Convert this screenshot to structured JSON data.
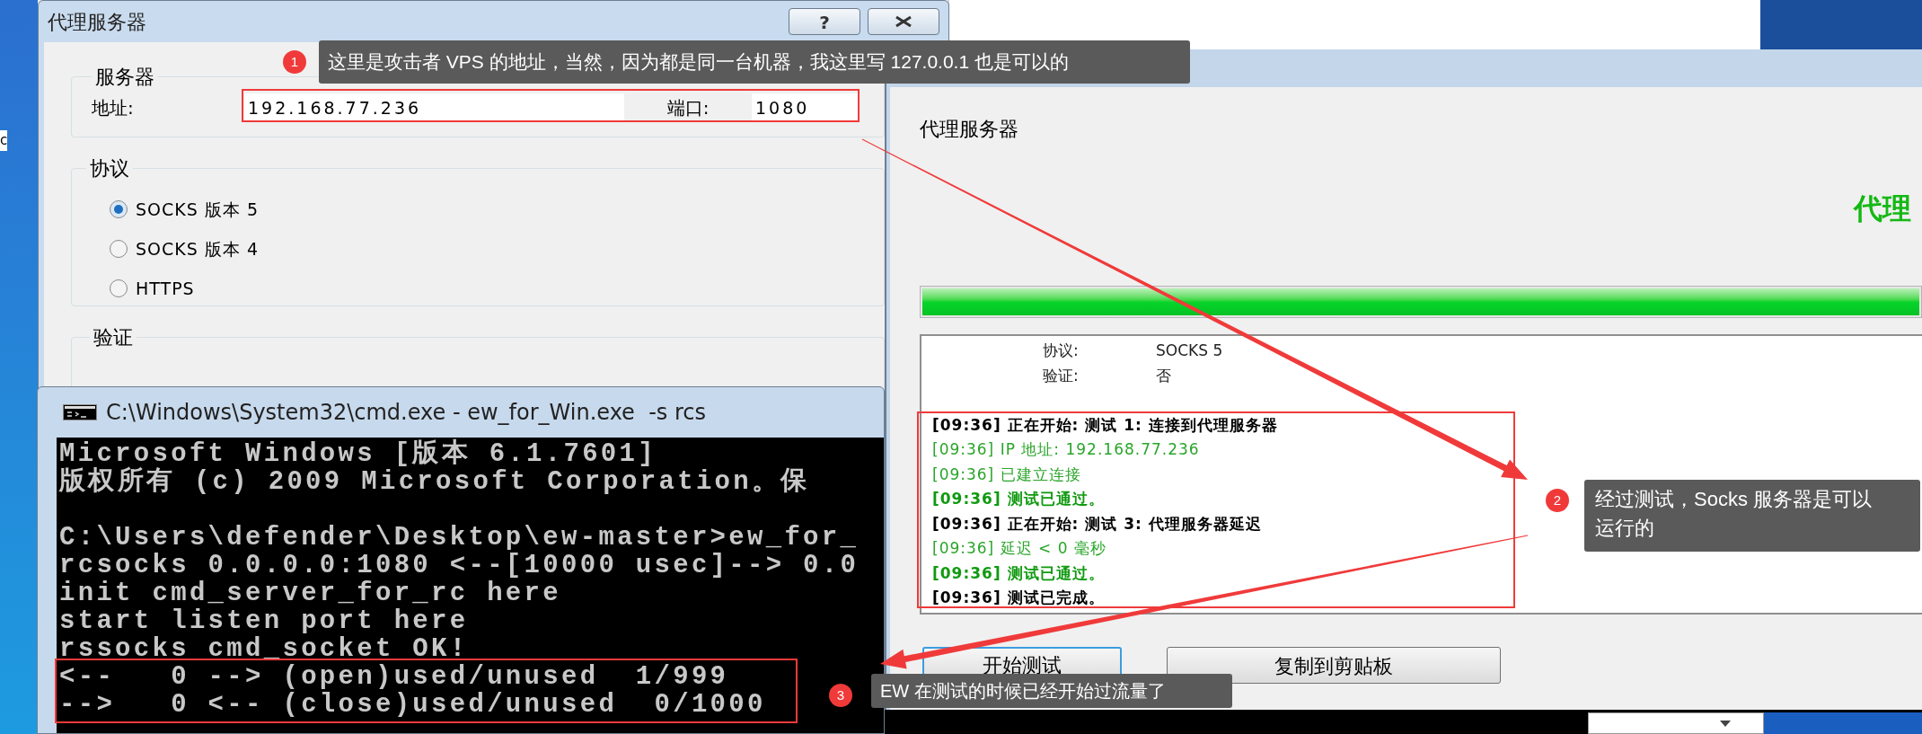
{
  "desktop": {
    "edge_text": "c"
  },
  "proxy_dialog": {
    "title": "代理服务器",
    "help_glyph": "?",
    "server_group": {
      "legend": "服务器",
      "address_label": "地址:",
      "address_value": "192.168.77.236",
      "port_label": "端口:",
      "port_value": "1080"
    },
    "protocol_group": {
      "legend": "协议",
      "options": [
        {
          "label": "SOCKS 版本 5",
          "selected": true
        },
        {
          "label": "SOCKS 版本 4",
          "selected": false
        },
        {
          "label": "HTTPS",
          "selected": false
        }
      ]
    },
    "auth_group": {
      "legend": "验证"
    }
  },
  "checker_window": {
    "heading": "代理服务器",
    "status_text": "代理",
    "progress": {
      "level": 1
    },
    "summary": [
      {
        "label": "协议:",
        "value": "SOCKS 5"
      },
      {
        "label": "验证:",
        "value": "否"
      }
    ],
    "log": [
      {
        "kind": "step",
        "text": "[09:36] 正在开始: 测试 1: 连接到代理服务器"
      },
      {
        "kind": "info",
        "text": "[09:36] IP 地址: 192.168.77.236"
      },
      {
        "kind": "info",
        "text": "[09:36] 已建立连接"
      },
      {
        "kind": "pass",
        "text": "[09:36] 测试已通过。"
      },
      {
        "kind": "step",
        "text": "[09:36] 正在开始: 测试 3: 代理服务器延迟"
      },
      {
        "kind": "info",
        "text": "[09:36] 延迟 < 0 毫秒"
      },
      {
        "kind": "pass",
        "text": "[09:36] 测试已通过。"
      },
      {
        "kind": "step",
        "text": "[09:36] 测试已完成。"
      }
    ],
    "buttons": [
      {
        "label": "开始测试",
        "default": true
      },
      {
        "label": "复制到剪贴板",
        "default": false
      }
    ]
  },
  "cmd_window": {
    "title": "C:\\Windows\\System32\\cmd.exe - ew_for_Win.exe  -s rcs",
    "banner_lines": [
      "Microsoft Windows [版本 6.1.7601]",
      "版权所有 (c) 2009 Microsoft Corporation。保"
    ],
    "session_lines": [
      "C:\\Users\\defender\\Desktop\\ew-master>ew_for_",
      "rcsocks 0.0.0.0:1080 <--[10000 usec]--> 0.0",
      "init cmd_server_for_rc here",
      "start listen port here",
      "rssocks cmd_socket OK!",
      "<--   0 --> (open)used/unused  1/999",
      "-->   0 <-- (close)used/unused  0/1000"
    ]
  },
  "annotations": [
    {
      "number": "1",
      "text": "这里是攻击者 VPS 的地址，当然，因为都是同一台机器，我这里写 127.0.0.1 也是可以的"
    },
    {
      "number": "2",
      "text": "经过测试，Socks 服务器是可以运行的"
    },
    {
      "number": "3",
      "text": "EW 在测试的时候已经开始过流量了"
    }
  ]
}
